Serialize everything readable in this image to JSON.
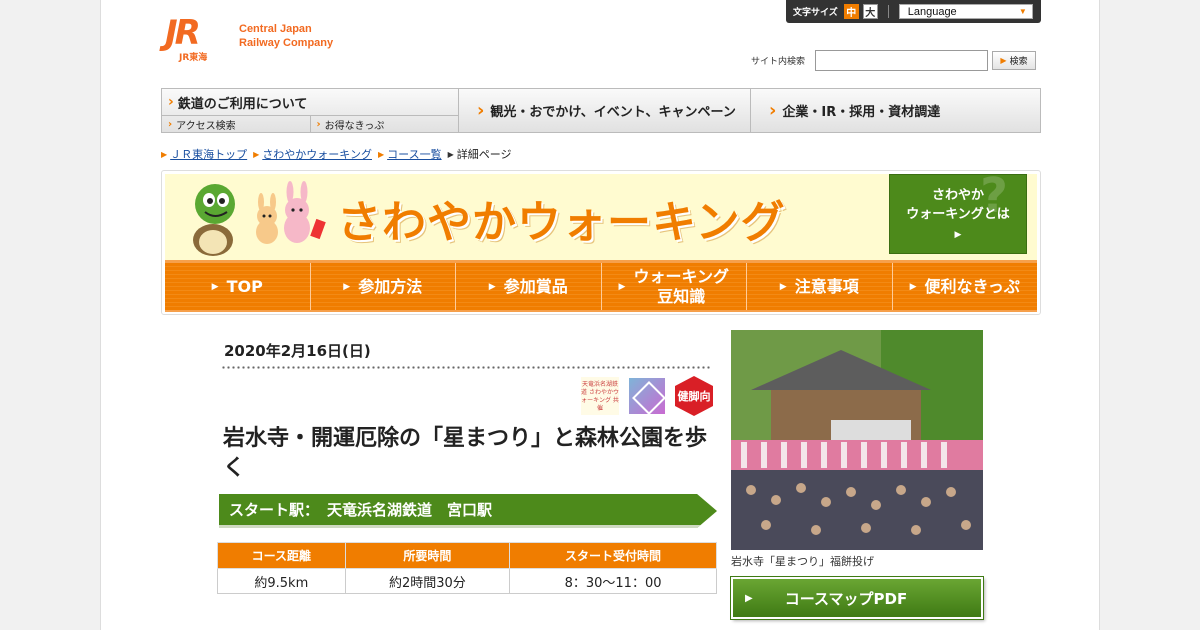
{
  "header": {
    "logo_mark": "JR",
    "logo_sub": "JR東海",
    "company_line1": "Central Japan",
    "company_line2": "Railway Company",
    "font_size_label": "文字サイズ",
    "size_medium": "中",
    "size_large": "大",
    "language_label": "Language",
    "search_label": "サイト内検索",
    "search_value": "",
    "search_button": "検索"
  },
  "gnav": {
    "railway_label": "鉄道のご利用について",
    "access_label": "アクセス検索",
    "tickets_label": "お得なきっぷ",
    "tourism_label": "観光・おでかけ、イベント、キャンペーン",
    "corporate_label": "企業・IR・採用・資材調達"
  },
  "breadcrumb": {
    "items": [
      "ＪＲ東海トップ",
      "さわやかウォーキング",
      "コース一覧"
    ],
    "current": "詳細ページ"
  },
  "banner": {
    "title": "さわやかウォーキング",
    "about_line1": "さわやか",
    "about_line2": "ウォーキングとは",
    "tabs": [
      "TOP",
      "参加方法",
      "参加賞品",
      "ウォーキング\n豆知識",
      "注意事項",
      "便利なきっぷ"
    ]
  },
  "event": {
    "date": "2020年2月16日(日)",
    "badge_text": "天竜浜名湖鉄道 さわやかウォーキング 共催",
    "badge_health": "健脚向",
    "title": "岩水寺・開運厄除の「星まつり」と森林公園を歩く",
    "start_label": "スタート駅：",
    "start_station": "天竜浜名湖鉄道　宮口駅",
    "table_headers": [
      "コース距離",
      "所要時間",
      "スタート受付時間"
    ],
    "table_values": [
      "約9.5km",
      "約2時間30分",
      "8：30～11：00"
    ]
  },
  "photo": {
    "caption": "岩水寺「星まつり」福餅投げ",
    "map_button": "コースマップPDF"
  },
  "colors": {
    "accent_orange": "#f07d00",
    "green": "#4d8a1b",
    "jr_orange": "#f26a21"
  }
}
